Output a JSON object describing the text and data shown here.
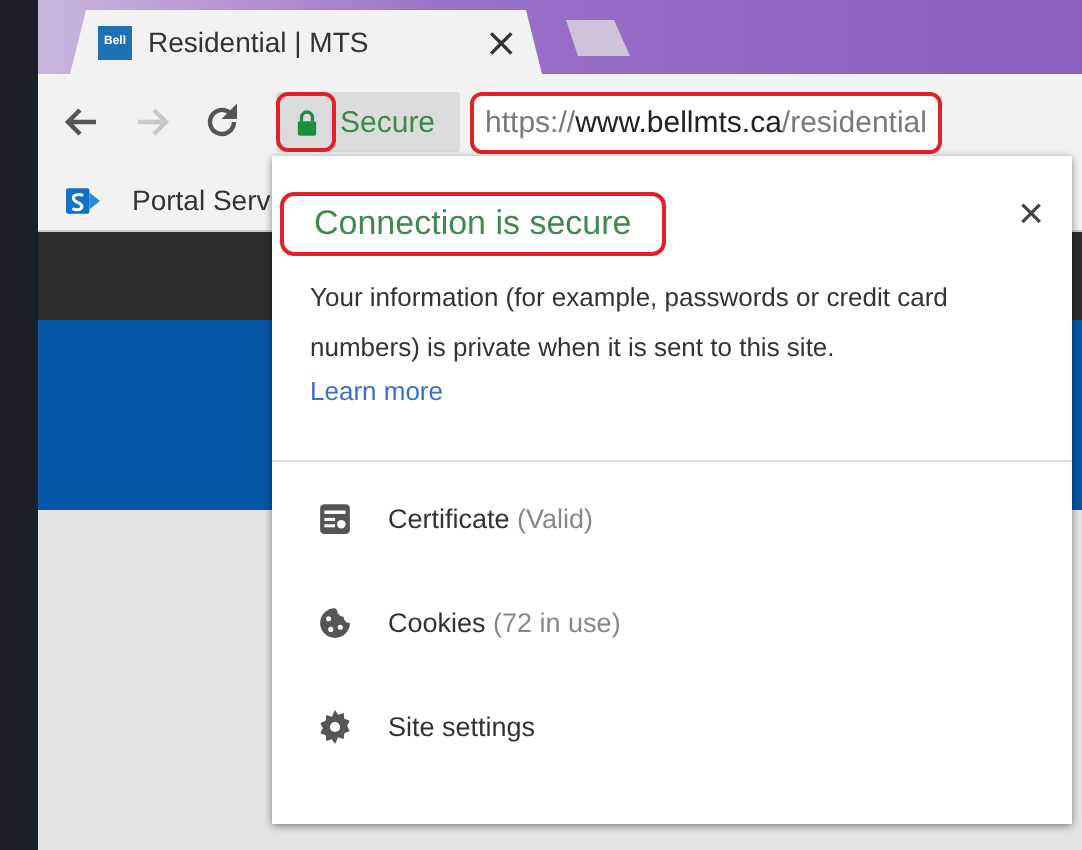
{
  "tab": {
    "favicon_text": "Bell",
    "title": "Residential | MTS",
    "close": "×",
    "selected": true
  },
  "toolbar": {
    "back_disabled": false,
    "forward_disabled": true
  },
  "security_chip": {
    "label": "Secure",
    "highlighted": true
  },
  "address": {
    "scheme": "https://",
    "host": "www.bellmts.ca",
    "path": "/residential",
    "highlighted": true
  },
  "bookmarks": [
    {
      "label": "Portal Serv"
    }
  ],
  "popup": {
    "title": "Connection is secure",
    "title_highlighted": true,
    "close": "×",
    "body": "Your information (for example, passwords or credit card numbers) is private when it is sent to this site.",
    "link": "Learn more",
    "items": [
      {
        "kind": "certificate",
        "label": "Certificate",
        "detail": "(Valid)"
      },
      {
        "kind": "cookies",
        "label": "Cookies",
        "detail": "(72 in use)"
      },
      {
        "kind": "settings",
        "label": "Site settings"
      }
    ]
  }
}
